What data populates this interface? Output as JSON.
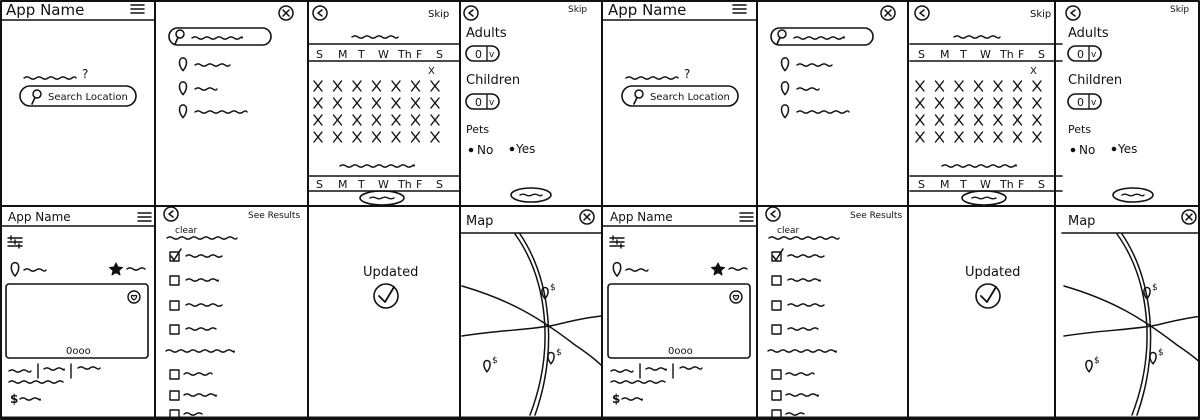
{
  "colors": {
    "ink": "#111111",
    "paper": "#ffffff"
  },
  "screens": {
    "home": {
      "app_name": "App Name",
      "search_label": "Search Location",
      "question_mark": "?"
    },
    "calendar": {
      "skip": "Skip",
      "days": [
        "S",
        "M",
        "T",
        "W",
        "Th",
        "F",
        "S"
      ],
      "lower_days": [
        "S",
        "M",
        "T",
        "W",
        "Th",
        "F",
        "S"
      ]
    },
    "guests": {
      "skip": "Skip",
      "adults": "Adults",
      "children": "Children",
      "pets": "Pets",
      "no": "No",
      "yes": "Yes",
      "stepper_value": "0",
      "stepper_caret": "v"
    },
    "results": {
      "app_name": "App Name",
      "pager": "0ooo"
    },
    "filters": {
      "see_results": "See Results",
      "clear": "clear"
    },
    "confirm": {
      "updated": "Updated"
    },
    "map": {
      "title": "Map",
      "pin_label": "$"
    }
  },
  "icons": [
    "menu-icon",
    "close-icon",
    "back-icon",
    "search-icon",
    "location-pin-icon",
    "star-icon",
    "heart-icon",
    "filter-icon",
    "checkmark-icon",
    "checkbox-icon"
  ]
}
